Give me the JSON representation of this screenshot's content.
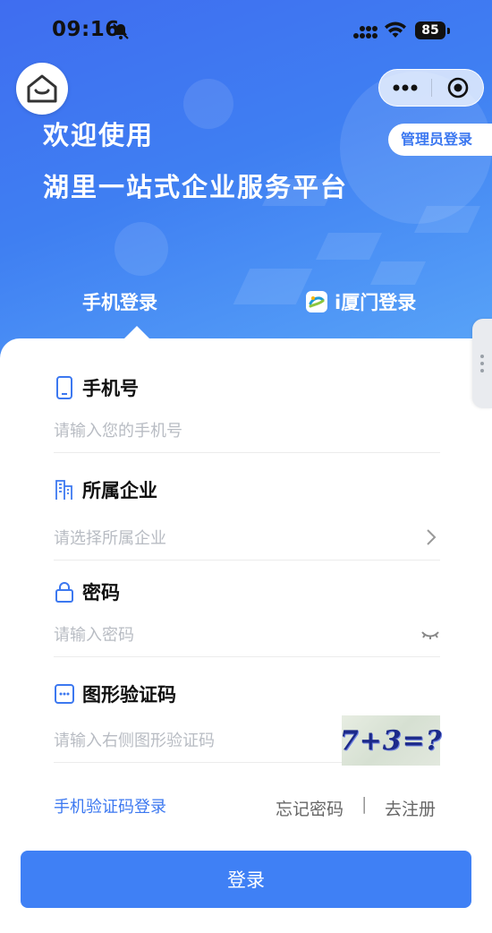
{
  "status_bar": {
    "time": "09:16",
    "battery": "85"
  },
  "header": {
    "admin_login": "管理员登录",
    "welcome": "欢迎使用",
    "platform_name": "湖里一站式企业服务平台"
  },
  "tabs": {
    "phone_login": "手机登录",
    "ixiamen_login": "i厦门登录"
  },
  "form": {
    "phone": {
      "label": "手机号",
      "placeholder": "请输入您的手机号"
    },
    "company": {
      "label": "所属企业",
      "placeholder": "请选择所属企业"
    },
    "password": {
      "label": "密码",
      "placeholder": "请输入密码"
    },
    "captcha": {
      "label": "图形验证码",
      "placeholder": "请输入右侧图形验证码",
      "image_text": "7+3=?"
    }
  },
  "links": {
    "sms_login": "手机验证码登录",
    "forgot_password": "忘记密码",
    "separator": "|",
    "register": "去注册"
  },
  "login_button": "登录",
  "colors": {
    "primary": "#3f80f5",
    "link": "#3c78f0",
    "header_gradient_start": "#3f6df0",
    "header_gradient_end": "#5aa6f8"
  }
}
